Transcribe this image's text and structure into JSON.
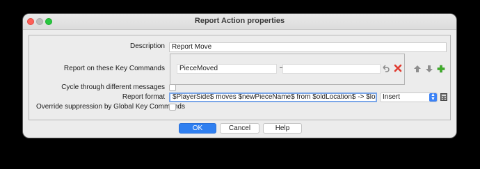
{
  "window": {
    "title": "Report Action properties"
  },
  "form": {
    "description_label": "Description",
    "description_value": "Report Move",
    "key_commands_label": "Report on these Key Commands",
    "key_command_value": "PieceMoved",
    "key_command_separator": "–",
    "key_command_second_value": "",
    "cycle_label": "Cycle through different messages",
    "cycle_checked": false,
    "report_format_label": "Report format",
    "report_format_value": "$PlayerSide$ moves $newPieceName$ from $oldLocation$ -> $location$",
    "insert_select_value": "Insert",
    "override_label": "Override suppression by Global Key Commands",
    "override_checked": false
  },
  "icons": {
    "undo": "undo-icon",
    "delete": "delete-x-icon",
    "move_up": "arrow-up-icon",
    "move_down": "arrow-down-icon",
    "add": "plus-icon",
    "expression": "expression-builder-icon"
  },
  "buttons": {
    "ok": "OK",
    "cancel": "Cancel",
    "help": "Help"
  },
  "colors": {
    "accent": "#2f7ff0",
    "delete": "#e03a2f",
    "add": "#3fae2a"
  }
}
